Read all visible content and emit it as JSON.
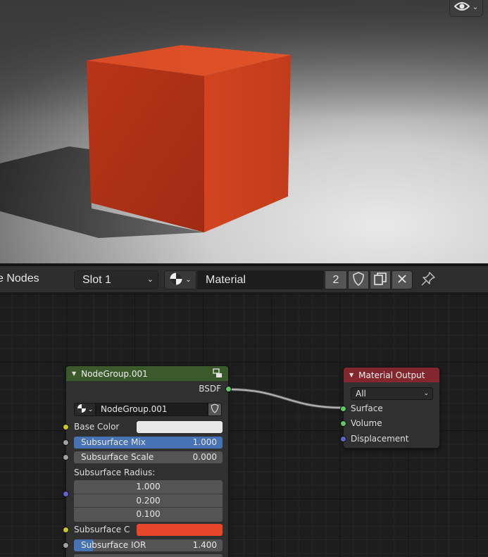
{
  "viewport": {
    "cube_color": "#c93a1e",
    "overlay_icon": "eye-icon"
  },
  "header": {
    "editor_title": "e Nodes",
    "slot": "Slot 1",
    "material_type_icon": "material-sphere-icon",
    "material_name": "Material",
    "user_count": "2",
    "fake_user_icon": "shield-icon",
    "duplicate_icon": "duplicate-icon",
    "unlink_icon": "close-icon",
    "pin_icon": "pin-icon"
  },
  "group_node": {
    "title": "NodeGroup.001",
    "header_color": "#3b5a2c",
    "output_label": "BSDF",
    "group_name": "NodeGroup.001",
    "inputs": {
      "base_color_label": "Base Color",
      "base_color_value": "#e8e8e8",
      "subsurface_mix_label": "Subsurface Mix",
      "subsurface_mix_value": "1.000",
      "subsurface_mix_fraction": 1.0,
      "subsurface_scale_label": "Subsurface Scale",
      "subsurface_scale_value": "0.000",
      "subsurface_radius_label": "Subsurface Radius:",
      "subsurface_radius_values": [
        "1.000",
        "0.200",
        "0.100"
      ],
      "subsurface_color_label": "Subsurface C",
      "subsurface_color_value": "#e7462a",
      "subsurface_ior_label": "Subsurface IOR",
      "subsurface_ior_value": "1.400",
      "subsurface_ior_fraction": 0.13
    }
  },
  "output_node": {
    "title": "Material Output",
    "header_color": "#83262e",
    "target": "All",
    "sockets": [
      "Surface",
      "Volume",
      "Displacement"
    ]
  }
}
